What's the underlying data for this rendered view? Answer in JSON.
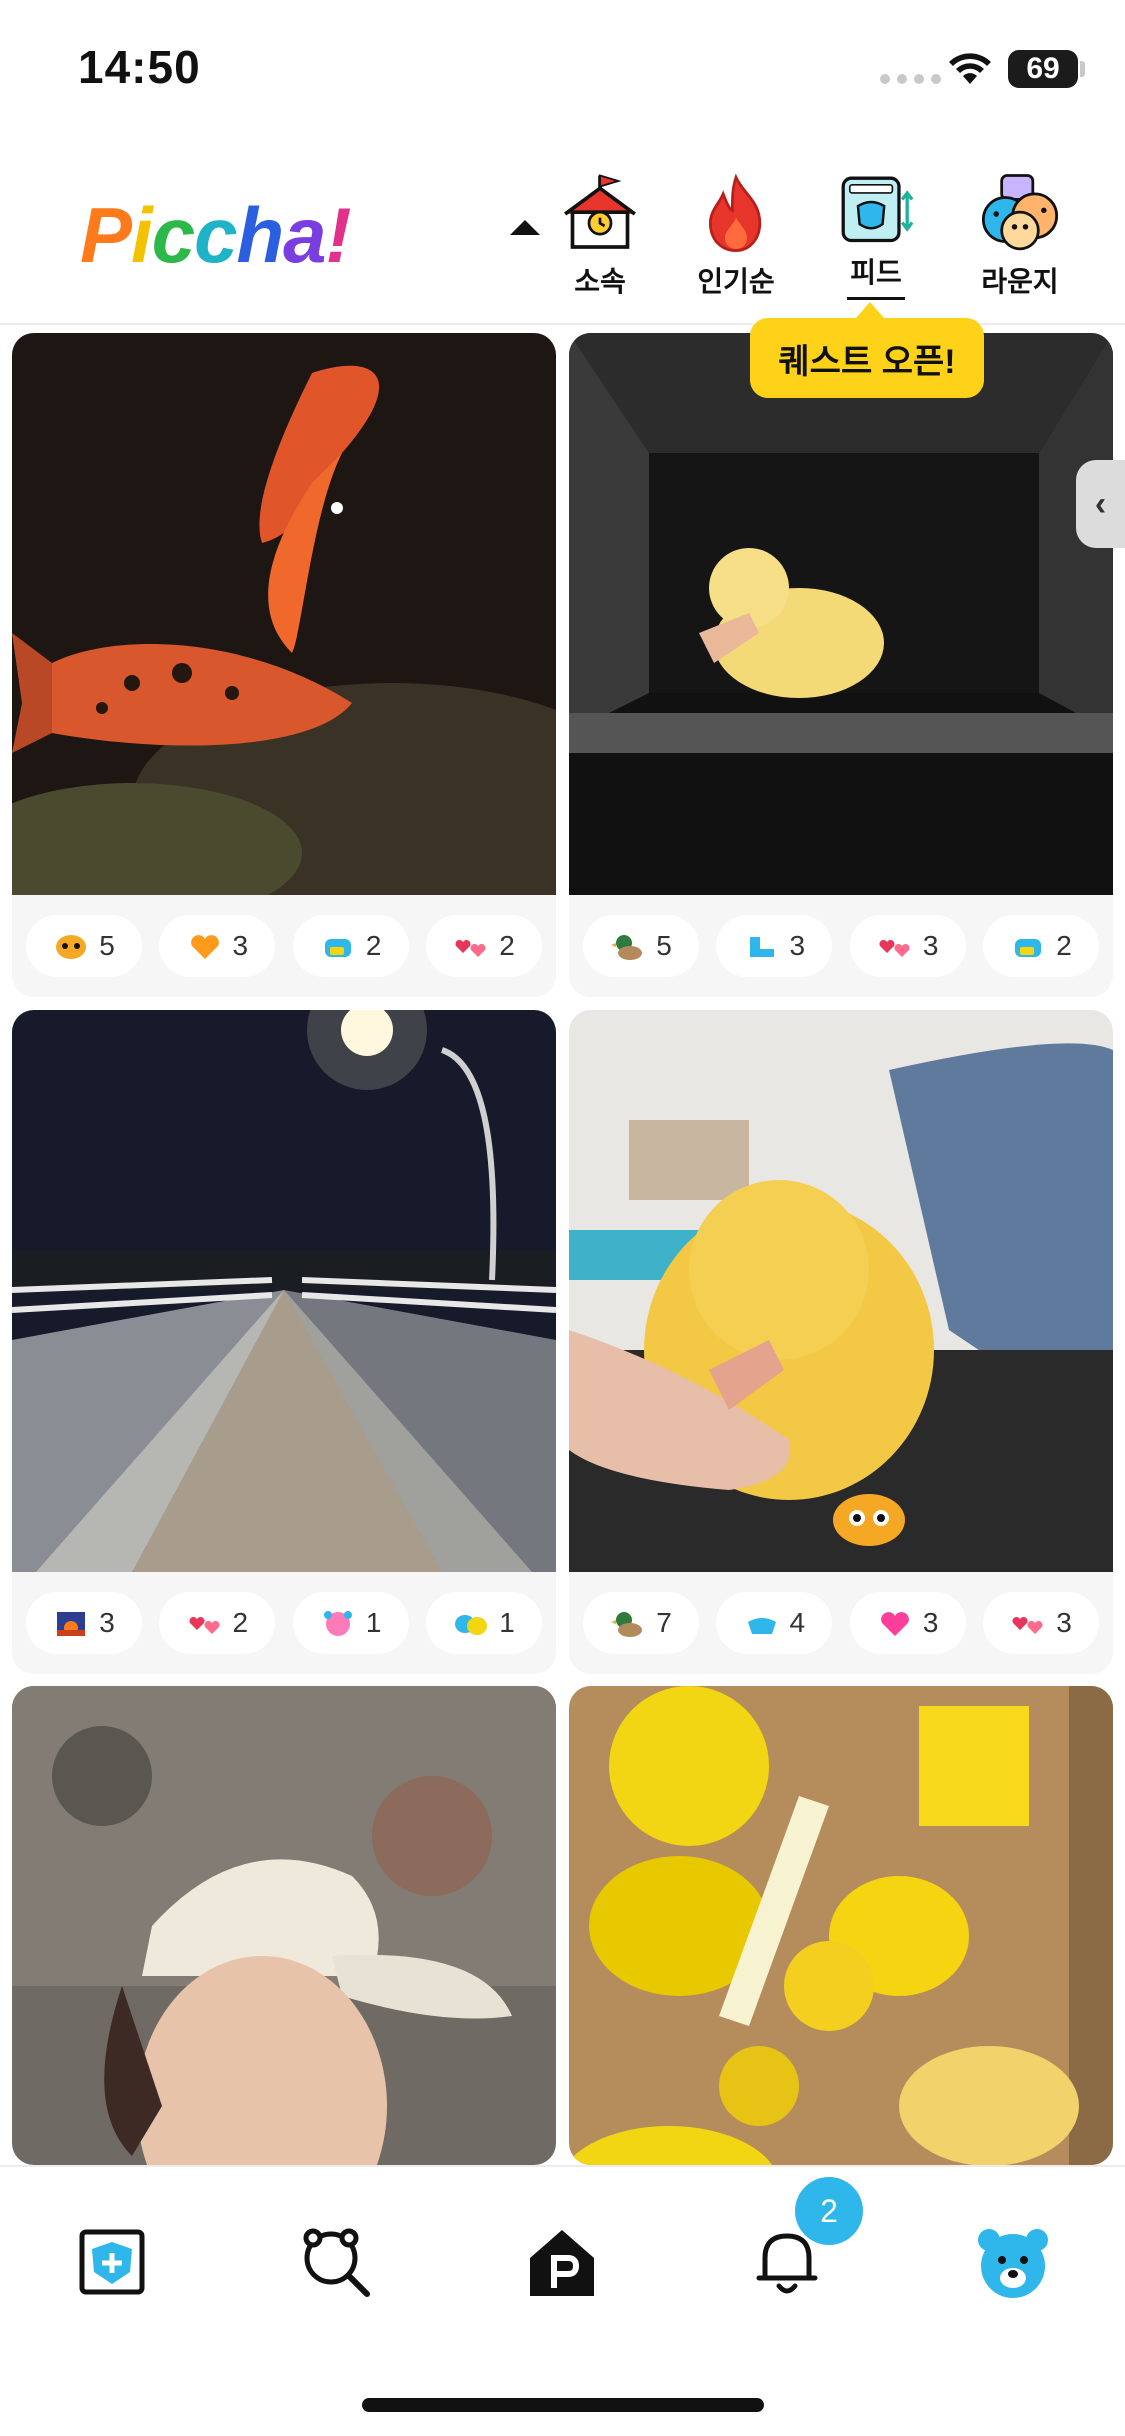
{
  "status_bar": {
    "time": "14:50",
    "battery": "69"
  },
  "header": {
    "logo_letters": [
      {
        "ch": "P",
        "color": "#ff7a1a"
      },
      {
        "ch": "i",
        "color": "#f2c200"
      },
      {
        "ch": "c",
        "color": "#2db84a"
      },
      {
        "ch": "c",
        "color": "#1fb3c7"
      },
      {
        "ch": "h",
        "color": "#2c5fe0"
      },
      {
        "ch": "a",
        "color": "#7a3de0"
      },
      {
        "ch": "!",
        "color": "#e0328a"
      }
    ],
    "tabs": [
      {
        "label": "소속",
        "icon": "school-icon"
      },
      {
        "label": "인기순",
        "icon": "fire-icon"
      },
      {
        "label": "피드",
        "icon": "feed-icon",
        "active": true
      },
      {
        "label": "라운지",
        "icon": "lounge-icon"
      }
    ],
    "tooltip": "퀘스트 오픈!"
  },
  "feed": [
    {
      "photo": "koi-fish-photo",
      "reactions": [
        {
          "icon": "cat-face-icon",
          "count": "5"
        },
        {
          "icon": "orange-heart-icon",
          "count": "3"
        },
        {
          "icon": "blue-cat-icon",
          "count": "2"
        },
        {
          "icon": "pink-hearts-icon",
          "count": "2"
        }
      ]
    },
    {
      "photo": "duckling-in-shelf-photo",
      "reactions": [
        {
          "icon": "duck-icon",
          "count": "5"
        },
        {
          "icon": "blue-boots-icon",
          "count": "3"
        },
        {
          "icon": "pink-hearts-icon",
          "count": "3"
        },
        {
          "icon": "blue-cat-icon",
          "count": "2"
        }
      ]
    },
    {
      "photo": "night-bridge-photo",
      "reactions": [
        {
          "icon": "sunset-icon",
          "count": "3"
        },
        {
          "icon": "pink-hearts-icon",
          "count": "2"
        },
        {
          "icon": "pink-bear-icon",
          "count": "1"
        },
        {
          "icon": "blue-yellow-cats-icon",
          "count": "1"
        }
      ]
    },
    {
      "photo": "duckling-in-hand-photo",
      "reactions": [
        {
          "icon": "duck-icon",
          "count": "7"
        },
        {
          "icon": "blue-hands-icon",
          "count": "4"
        },
        {
          "icon": "pink-heart-icon",
          "count": "3"
        },
        {
          "icon": "pink-hearts-icon",
          "count": "3"
        }
      ]
    },
    {
      "photo": "person-with-cap-photo",
      "reactions": []
    },
    {
      "photo": "yellow-toys-box-photo",
      "reactions": []
    }
  ],
  "tabbar": {
    "items": [
      "upload-icon",
      "search-icon",
      "home-icon",
      "bell-icon",
      "profile-bear-icon"
    ],
    "notification_count": "2"
  },
  "colors": {
    "accent": "#2fb6ea",
    "tooltip": "#ffd21a"
  }
}
